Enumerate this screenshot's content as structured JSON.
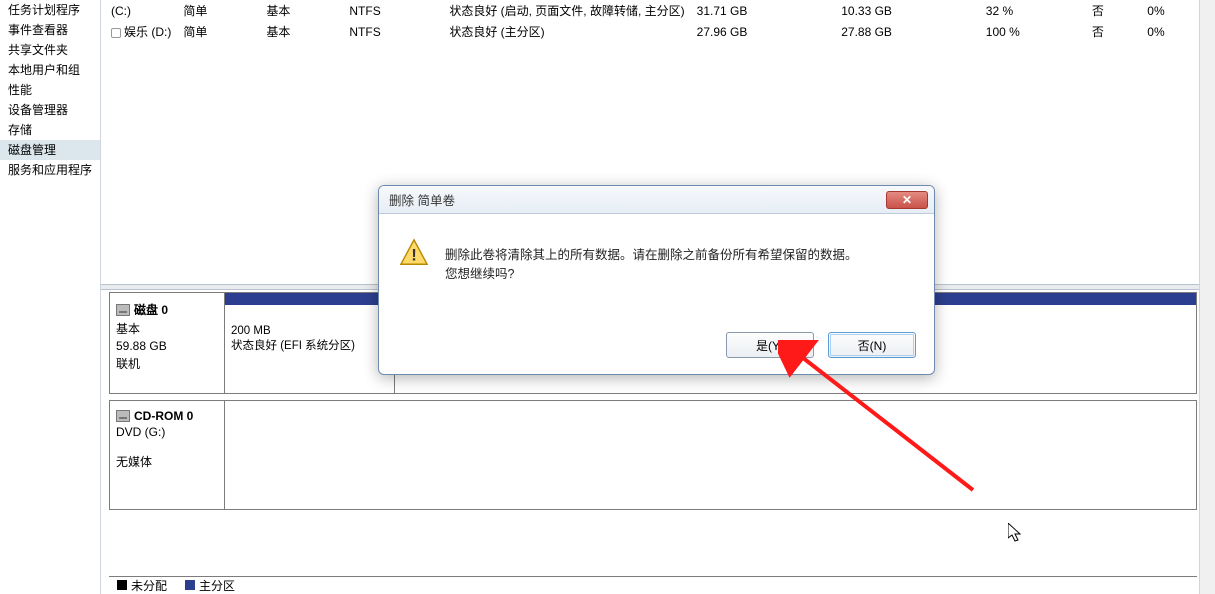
{
  "sidebar": {
    "items": [
      "任务计划程序",
      "事件查看器",
      "共享文件夹",
      "本地用户和组",
      "性能",
      "设备管理器",
      "存储",
      "磁盘管理",
      "服务和应用程序"
    ],
    "selected_index": 7
  },
  "volumes": [
    {
      "name": "(C:)",
      "layout": "简单",
      "type": "基本",
      "fs": "NTFS",
      "status": "状态良好 (启动, 页面文件, 故障转储, 主分区)",
      "capacity": "31.71 GB",
      "free": "10.33 GB",
      "pct": "32 %",
      "fault": "否",
      "overhead": "0%"
    },
    {
      "name": "娱乐 (D:)",
      "layout": "简单",
      "type": "基本",
      "fs": "NTFS",
      "status": "状态良好 (主分区)",
      "capacity": "27.96 GB",
      "free": "27.88 GB",
      "pct": "100 %",
      "fault": "否",
      "overhead": "0%"
    }
  ],
  "disk0": {
    "title": "磁盘 0",
    "kind": "基本",
    "size": "59.88 GB",
    "state": "联机",
    "part1_size": "200 MB",
    "part1_status": "状态良好 (EFI 系统分区)"
  },
  "cdrom": {
    "title": "CD-ROM 0",
    "kind": "DVD (G:)",
    "state": "无媒体"
  },
  "legend": {
    "a": "未分配",
    "b": "主分区"
  },
  "dialog": {
    "title": "删除 简单卷",
    "line1": "删除此卷将清除其上的所有数据。请在删除之前备份所有希望保留的数据。",
    "line2": "您想继续吗?",
    "yes": "是(Y)",
    "no": "否(N)"
  }
}
